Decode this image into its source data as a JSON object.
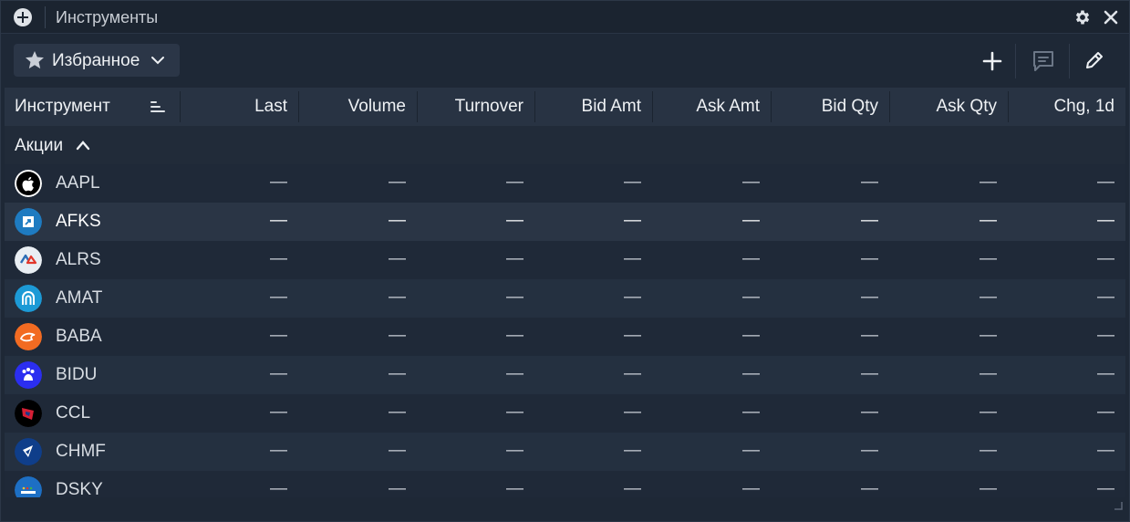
{
  "window": {
    "title": "Инструменты"
  },
  "toolbar": {
    "favorites_label": "Избранное"
  },
  "table": {
    "columns": [
      "Инструмент",
      "Last",
      "Volume",
      "Turnover",
      "Bid Amt",
      "Ask Amt",
      "Bid Qty",
      "Ask Qty",
      "Chg, 1d"
    ],
    "group_label": "Акции",
    "empty_value": "—",
    "rows": [
      {
        "ticker": "AAPL",
        "logo": "apple-logo"
      },
      {
        "ticker": "AFKS",
        "logo": "sistema-logo"
      },
      {
        "ticker": "ALRS",
        "logo": "alrosa-logo"
      },
      {
        "ticker": "AMAT",
        "logo": "applied-materials-logo"
      },
      {
        "ticker": "BABA",
        "logo": "alibaba-logo"
      },
      {
        "ticker": "BIDU",
        "logo": "baidu-logo"
      },
      {
        "ticker": "CCL",
        "logo": "carnival-logo"
      },
      {
        "ticker": "CHMF",
        "logo": "severstal-logo"
      },
      {
        "ticker": "DSKY",
        "logo": "detsky-mir-logo"
      }
    ]
  },
  "colors": {
    "background": "#1e2836",
    "header": "#283343",
    "row_hover": "#2a3545",
    "text": "#eef1f4"
  }
}
